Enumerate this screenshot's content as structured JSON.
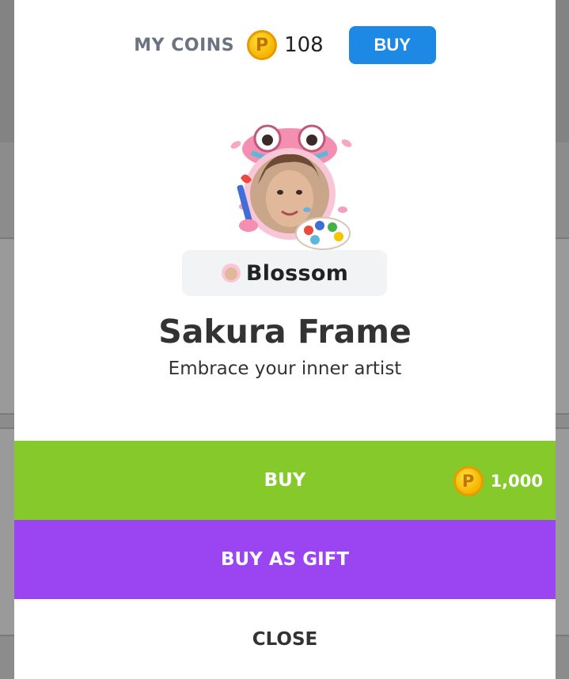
{
  "wallet": {
    "label": "MY COINS",
    "coin_symbol": "P",
    "balance": "108",
    "buy_label": "BUY"
  },
  "item": {
    "frame_name": "Blossom",
    "title": "Sakura Frame",
    "subtitle": "Embrace your inner artist"
  },
  "actions": {
    "buy_label": "BUY",
    "price_coin_symbol": "P",
    "price": "1,000",
    "gift_label": "BUY AS GIFT",
    "close_label": "CLOSE"
  },
  "colors": {
    "buy_green": "#85c92a",
    "gift_purple": "#9b44f2",
    "top_buy_blue": "#1e88e5",
    "coin_gold": "#f5b400"
  }
}
